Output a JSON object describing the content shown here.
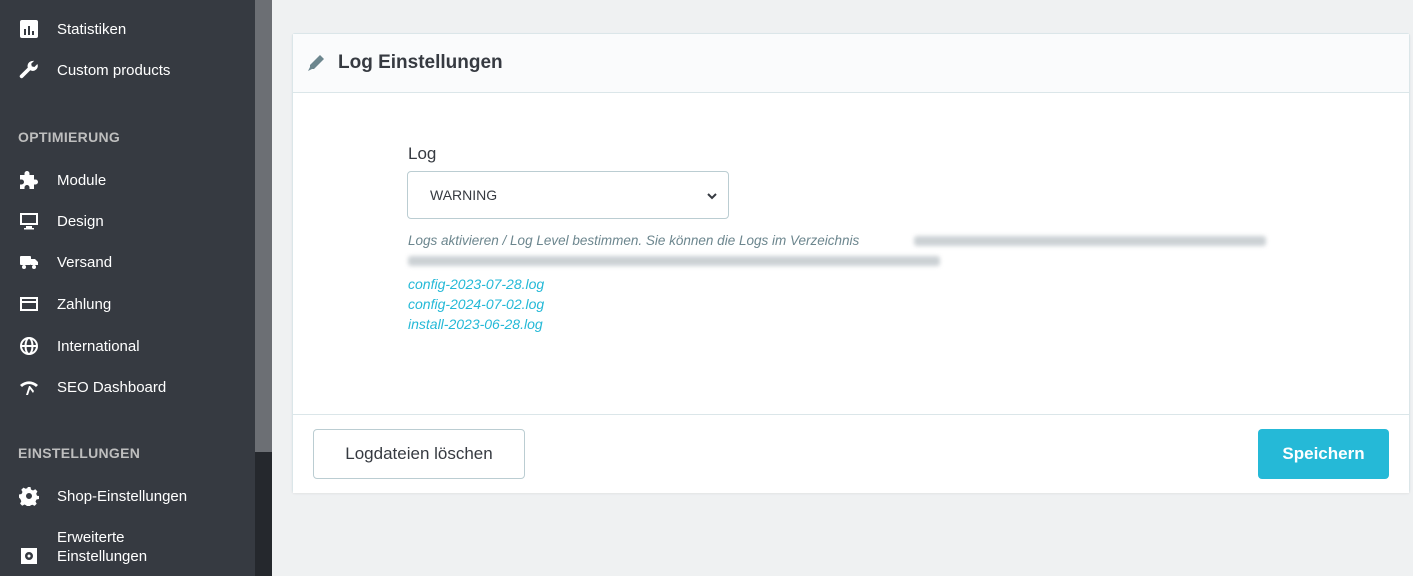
{
  "sidebar": {
    "items_top": [
      {
        "label": "Statistiken",
        "icon": "bar-chart-icon"
      },
      {
        "label": "Custom products",
        "icon": "wrench-icon"
      }
    ],
    "section_optimierung": "OPTIMIERUNG",
    "items_optimierung": [
      {
        "label": "Module",
        "icon": "puzzle-icon"
      },
      {
        "label": "Design",
        "icon": "monitor-icon"
      },
      {
        "label": "Versand",
        "icon": "truck-icon"
      },
      {
        "label": "Zahlung",
        "icon": "credit-card-icon"
      },
      {
        "label": "International",
        "icon": "globe-icon"
      },
      {
        "label": "SEO Dashboard",
        "icon": "seo-icon"
      }
    ],
    "section_einstellungen": "EINSTELLUNGEN",
    "items_einstellungen": [
      {
        "label": "Shop-Einstellungen",
        "icon": "gear-icon"
      },
      {
        "label_line1": "Erweiterte",
        "label_line2": "Einstellungen",
        "icon": "settings-box-icon"
      }
    ]
  },
  "card": {
    "title": "Log Einstellungen",
    "field_label": "Log",
    "select_value": "WARNING",
    "help_text": "Logs aktivieren / Log Level bestimmen. Sie können die Logs im Verzeichnis",
    "log_files": [
      "config-2023-07-28.log",
      "config-2024-07-02.log",
      "install-2023-06-28.log"
    ],
    "delete_button": "Logdateien löschen",
    "save_button": "Speichern"
  },
  "colors": {
    "sidebar_bg": "#363a41",
    "accent": "#25b9d7",
    "page_bg": "#eff1f2"
  }
}
